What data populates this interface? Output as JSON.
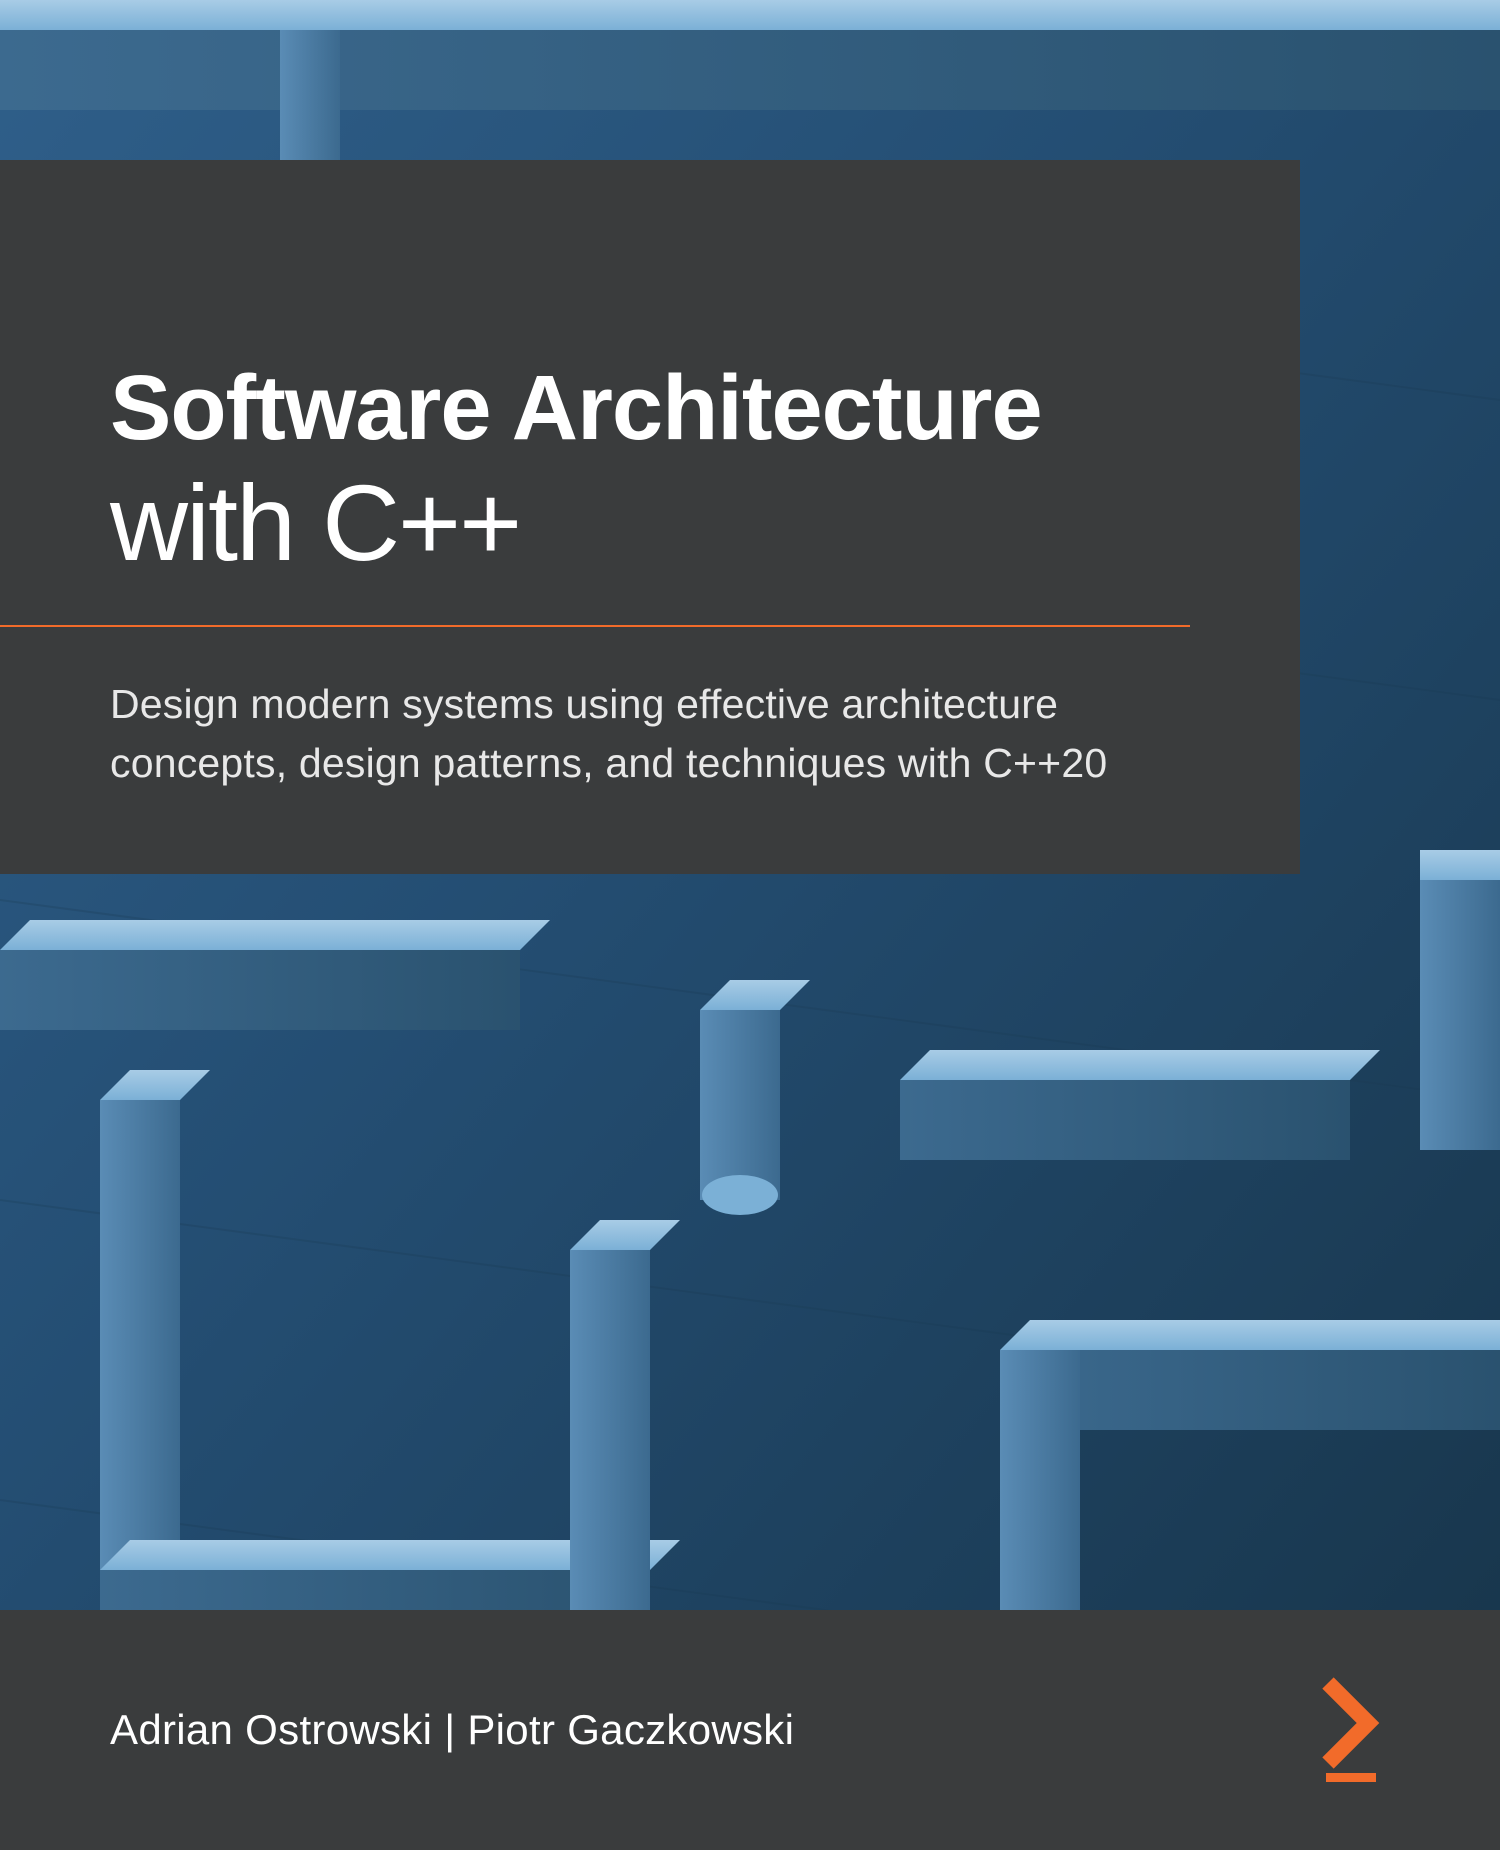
{
  "title": {
    "line1": "Software Architecture",
    "line2": "with C++"
  },
  "subtitle": "Design modern systems using effective architecture concepts, design patterns, and techniques with C++20",
  "authors": "Adrian Ostrowski | Piotr Gaczkowski",
  "colors": {
    "panel": "#3a3c3d",
    "accent": "#f26b2a",
    "bg_dark": "#1a3550",
    "bg_light": "#6a9cc4"
  }
}
